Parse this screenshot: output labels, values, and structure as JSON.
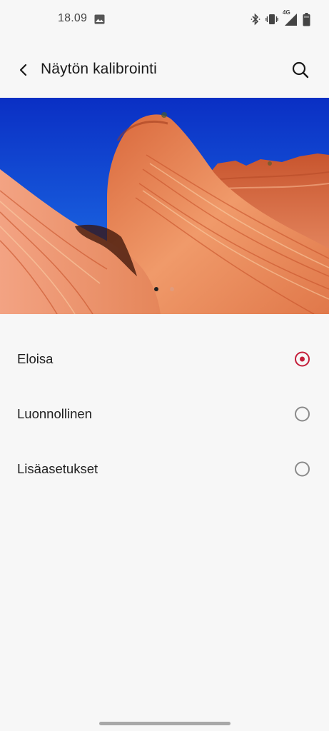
{
  "status_bar": {
    "time": "18.09",
    "network_label": "4G",
    "icons": [
      "gallery-icon",
      "bluetooth-icon",
      "vibrate-icon",
      "signal-icon",
      "battery-icon"
    ]
  },
  "header": {
    "title": "Näytön kalibrointi",
    "back_icon": "back-arrow-icon",
    "search_icon": "search-icon"
  },
  "preview": {
    "image": "sandstone wave landscape under blue sky",
    "page_count": 2,
    "current_page": 1
  },
  "options": [
    {
      "label": "Eloisa",
      "selected": true
    },
    {
      "label": "Luonnollinen",
      "selected": false
    },
    {
      "label": "Lisäasetukset",
      "selected": false
    }
  ],
  "colors": {
    "background": "#f7f7f7",
    "accent": "#c41e3a",
    "text": "#1f1f1f"
  }
}
